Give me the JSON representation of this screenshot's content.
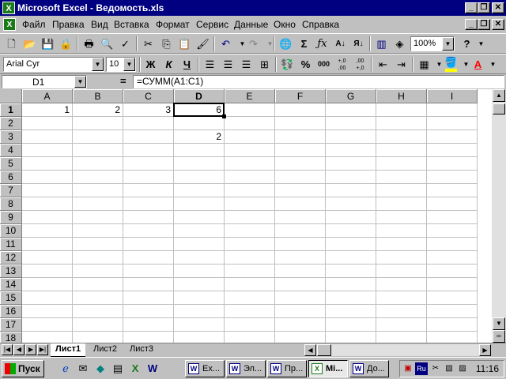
{
  "window": {
    "title": "Microsoft Excel - Ведомость.xls",
    "app_icon": "X"
  },
  "menu": {
    "doc_icon": "X",
    "items": [
      "Файл",
      "Правка",
      "Вид",
      "Вставка",
      "Формат",
      "Сервис",
      "Данные",
      "Окно",
      "Справка"
    ]
  },
  "standard_toolbar": {
    "zoom": "100%"
  },
  "format_toolbar": {
    "font_name": "Arial Cyr",
    "font_size": "10",
    "bold_label": "Ж",
    "italic_label": "К",
    "underline_label": "Ч",
    "percent_label": "%",
    "thousands_label": "000",
    "inc_decimal_label": "+,0 ,00",
    "dec_decimal_label": ",00 +,0",
    "fill_color": "#ffff00",
    "font_color": "#ff0000"
  },
  "formula_bar": {
    "name_box": "D1",
    "equals": "=",
    "formula": "=СУММ(A1:C1)"
  },
  "grid": {
    "columns": [
      "A",
      "B",
      "C",
      "D",
      "E",
      "F",
      "G",
      "H",
      "I"
    ],
    "rows": [
      "1",
      "2",
      "3",
      "4",
      "5",
      "6",
      "7",
      "8",
      "9",
      "10",
      "11",
      "12",
      "13",
      "14",
      "15",
      "16",
      "17",
      "18"
    ],
    "active_cell": "D1",
    "cells": {
      "A1": "1",
      "B1": "2",
      "C1": "3",
      "D1": "6",
      "D3": "2"
    }
  },
  "sheets": {
    "tabs": [
      "Лист1",
      "Лист2",
      "Лист3"
    ],
    "active": "Лист1"
  },
  "taskbar": {
    "start_label": "Пуск",
    "tasks": [
      {
        "label": "Ex...",
        "active": false
      },
      {
        "label": "Эл...",
        "active": false
      },
      {
        "label": "Пр...",
        "active": false
      },
      {
        "label": "Mi...",
        "active": true
      },
      {
        "label": "До...",
        "active": false
      }
    ],
    "language": "Ru",
    "clock": "11:16"
  }
}
